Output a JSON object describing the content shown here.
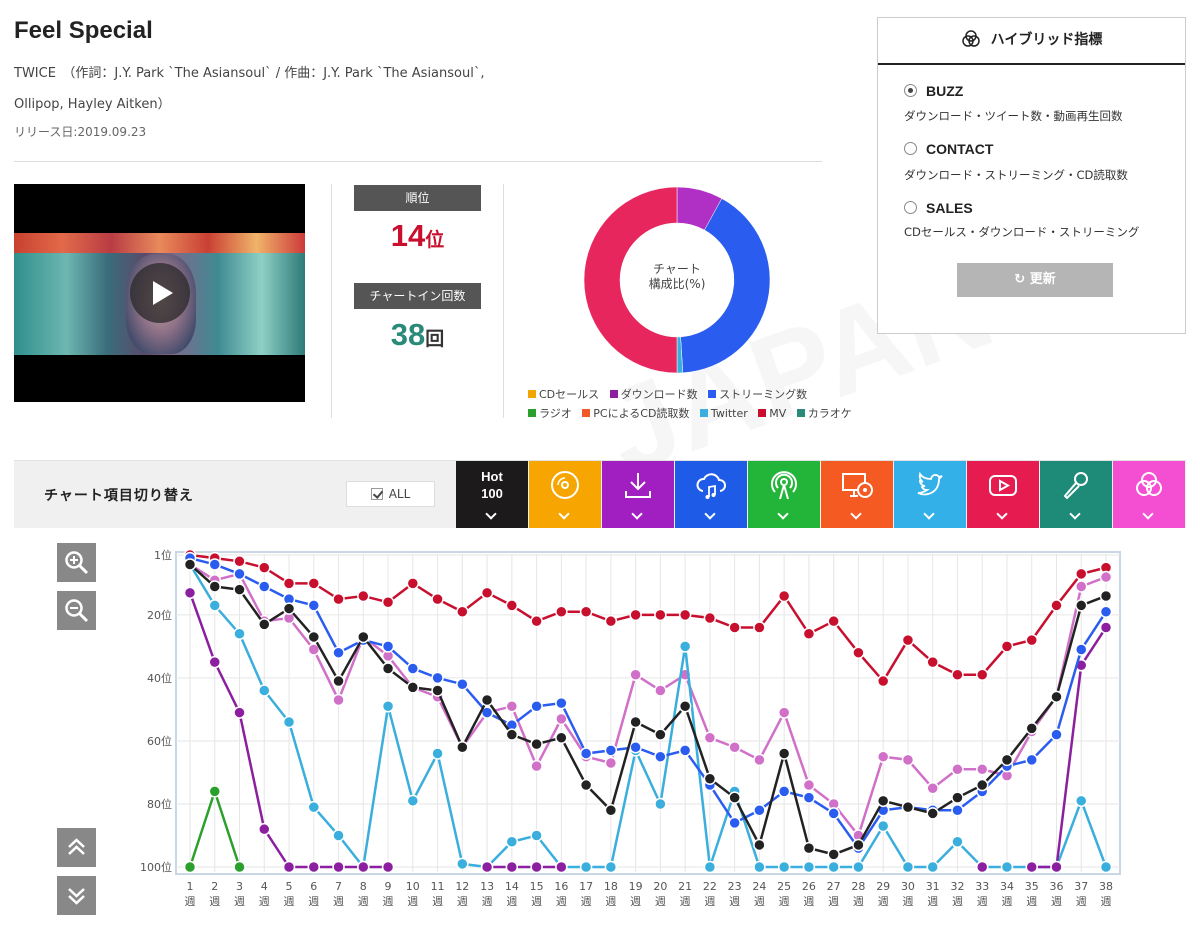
{
  "song": {
    "title": "Feel Special",
    "credit_line1": "TWICE　（作詞：J.Y. Park `The Asiansoul` / 作曲：J.Y. Park `The Asiansoul`,",
    "credit_line2": "Ollipop, Hayley Aitken）",
    "release": "リリース日:2019.09.23"
  },
  "stats": {
    "rank_label": "順位",
    "rank_value": "14",
    "rank_unit": "位",
    "chartin_label": "チャートイン回数",
    "chartin_value": "38",
    "chartin_unit": "回"
  },
  "composition": {
    "center_line1": "チャート",
    "center_line2": "構成比(%)",
    "slices": [
      {
        "name": "ダウンロード数",
        "share": 0.08,
        "color": "#b02fc4"
      },
      {
        "name": "ストリーミング数",
        "share": 0.41,
        "color": "#2b5cf0"
      },
      {
        "name": "Twitter",
        "share": 0.01,
        "color": "#3aaedc"
      },
      {
        "name": "MV",
        "share": 0.5,
        "color": "#e8265e"
      }
    ],
    "legend": [
      {
        "label": "CDセールス",
        "color": "#f0a500"
      },
      {
        "label": "ダウンロード数",
        "color": "#8b1fa0"
      },
      {
        "label": "ストリーミング数",
        "color": "#2b5cf0"
      },
      {
        "label": "ラジオ",
        "color": "#2ca02c"
      },
      {
        "label": "PCによるCD読取数",
        "color": "#f05a28"
      },
      {
        "label": "Twitter",
        "color": "#3aaedc"
      },
      {
        "label": "MV",
        "color": "#c8102e"
      },
      {
        "label": "カラオケ",
        "color": "#2a8a7a"
      }
    ]
  },
  "hybrid": {
    "title": "ハイブリッド指標",
    "options": [
      {
        "name": "BUZZ",
        "desc": "ダウンロード・ツイート数・動画再生回数",
        "selected": true
      },
      {
        "name": "CONTACT",
        "desc": "ダウンロード・ストリーミング・CD読取数",
        "selected": false
      },
      {
        "name": "SALES",
        "desc": "CDセールス・ダウンロード・ストリーミング",
        "selected": false
      }
    ],
    "refresh_label": "更新"
  },
  "toolbar": {
    "title": "チャート項目切り替え",
    "all_label": "ALL",
    "hot_label_1": "Hot",
    "hot_label_2": "100",
    "tabs": [
      {
        "name": "hot100",
        "icon": "hot100",
        "color": "#1c1a1a"
      },
      {
        "name": "cd-sales",
        "icon": "cd-icon",
        "color": "#f7a500"
      },
      {
        "name": "download",
        "icon": "download-icon",
        "color": "#a11fc0"
      },
      {
        "name": "streaming",
        "icon": "cloud-music-icon",
        "color": "#1e5be6"
      },
      {
        "name": "radio",
        "icon": "radio-icon",
        "color": "#23b43a"
      },
      {
        "name": "pc-cd-read",
        "icon": "pc-cd-icon",
        "color": "#f55a23"
      },
      {
        "name": "twitter",
        "icon": "twitter-icon",
        "color": "#34b0e8"
      },
      {
        "name": "mv",
        "icon": "youtube-icon",
        "color": "#e61c50"
      },
      {
        "name": "karaoke",
        "icon": "mic-icon",
        "color": "#1e8a78"
      },
      {
        "name": "hybrid",
        "icon": "hybrid-icon",
        "color": "#f44fd3"
      }
    ]
  },
  "chart_data": {
    "type": "line",
    "y_reversed": true,
    "ylim": [
      1,
      100
    ],
    "ytick_labels": [
      "1位",
      "20位",
      "40位",
      "60位",
      "80位",
      "100位"
    ],
    "ytick_values": [
      1,
      20,
      40,
      60,
      80,
      100
    ],
    "x": [
      1,
      2,
      3,
      4,
      5,
      6,
      7,
      8,
      9,
      10,
      11,
      12,
      13,
      14,
      15,
      16,
      17,
      18,
      19,
      20,
      21,
      22,
      23,
      24,
      25,
      26,
      27,
      28,
      29,
      30,
      31,
      32,
      33,
      34,
      35,
      36,
      37,
      38
    ],
    "xtick_suffix": "週",
    "grid": true,
    "series": [
      {
        "color": "#c8102e",
        "values": [
          1,
          2,
          3,
          5,
          10,
          10,
          15,
          14,
          16,
          10,
          15,
          19,
          13,
          17,
          22,
          19,
          19,
          22,
          20,
          20,
          20,
          21,
          24,
          24,
          14,
          26,
          22,
          32,
          41,
          28,
          35,
          39,
          39,
          30,
          28,
          17,
          7,
          5
        ]
      },
      {
        "color": "#d070c8",
        "values": [
          4,
          9,
          7,
          22,
          21,
          31,
          47,
          27,
          33,
          43,
          46,
          62,
          51,
          49,
          68,
          53,
          65,
          67,
          39,
          44,
          39,
          59,
          62,
          66,
          51,
          74,
          80,
          90,
          65,
          66,
          75,
          69,
          69,
          71,
          57,
          46,
          11,
          8
        ]
      },
      {
        "color": "#3aaedc",
        "values": [
          4,
          17,
          26,
          44,
          54,
          81,
          90,
          100,
          49,
          79,
          64,
          99,
          100,
          92,
          90,
          100,
          100,
          100,
          63,
          80,
          30,
          100,
          76,
          100,
          100,
          100,
          100,
          100,
          87,
          100,
          100,
          92,
          100,
          100,
          100,
          100,
          79,
          100
        ]
      },
      {
        "color": "#8b1fa0",
        "values": [
          13,
          35,
          51,
          88,
          100,
          100,
          100,
          100,
          100,
          null,
          null,
          null,
          100,
          100,
          100,
          100,
          null,
          null,
          null,
          null,
          null,
          null,
          null,
          null,
          null,
          null,
          null,
          null,
          null,
          null,
          null,
          null,
          100,
          null,
          100,
          100,
          36,
          24
        ]
      },
      {
        "color": "#2ca02c",
        "values": [
          100,
          76,
          100,
          null,
          null,
          null,
          null,
          null,
          null,
          null,
          null,
          null,
          null,
          null,
          null,
          null,
          null,
          null,
          null,
          null,
          null,
          null,
          null,
          null,
          null,
          null,
          null,
          null,
          null,
          null,
          null,
          null,
          null,
          null,
          null,
          null,
          null,
          null
        ]
      },
      {
        "color": "#2b5cf0",
        "values": [
          2,
          4,
          7,
          11,
          15,
          17,
          32,
          28,
          30,
          37,
          40,
          42,
          51,
          55,
          49,
          48,
          64,
          63,
          62,
          65,
          63,
          74,
          86,
          82,
          76,
          78,
          83,
          94,
          82,
          81,
          82,
          82,
          76,
          68,
          66,
          58,
          31,
          19
        ]
      },
      {
        "color": "#222222",
        "values": [
          4,
          11,
          12,
          23,
          18,
          27,
          41,
          27,
          37,
          43,
          44,
          62,
          47,
          58,
          61,
          59,
          74,
          82,
          54,
          58,
          49,
          72,
          78,
          93,
          64,
          94,
          96,
          93,
          79,
          81,
          83,
          78,
          74,
          66,
          56,
          46,
          17,
          14
        ]
      }
    ]
  }
}
